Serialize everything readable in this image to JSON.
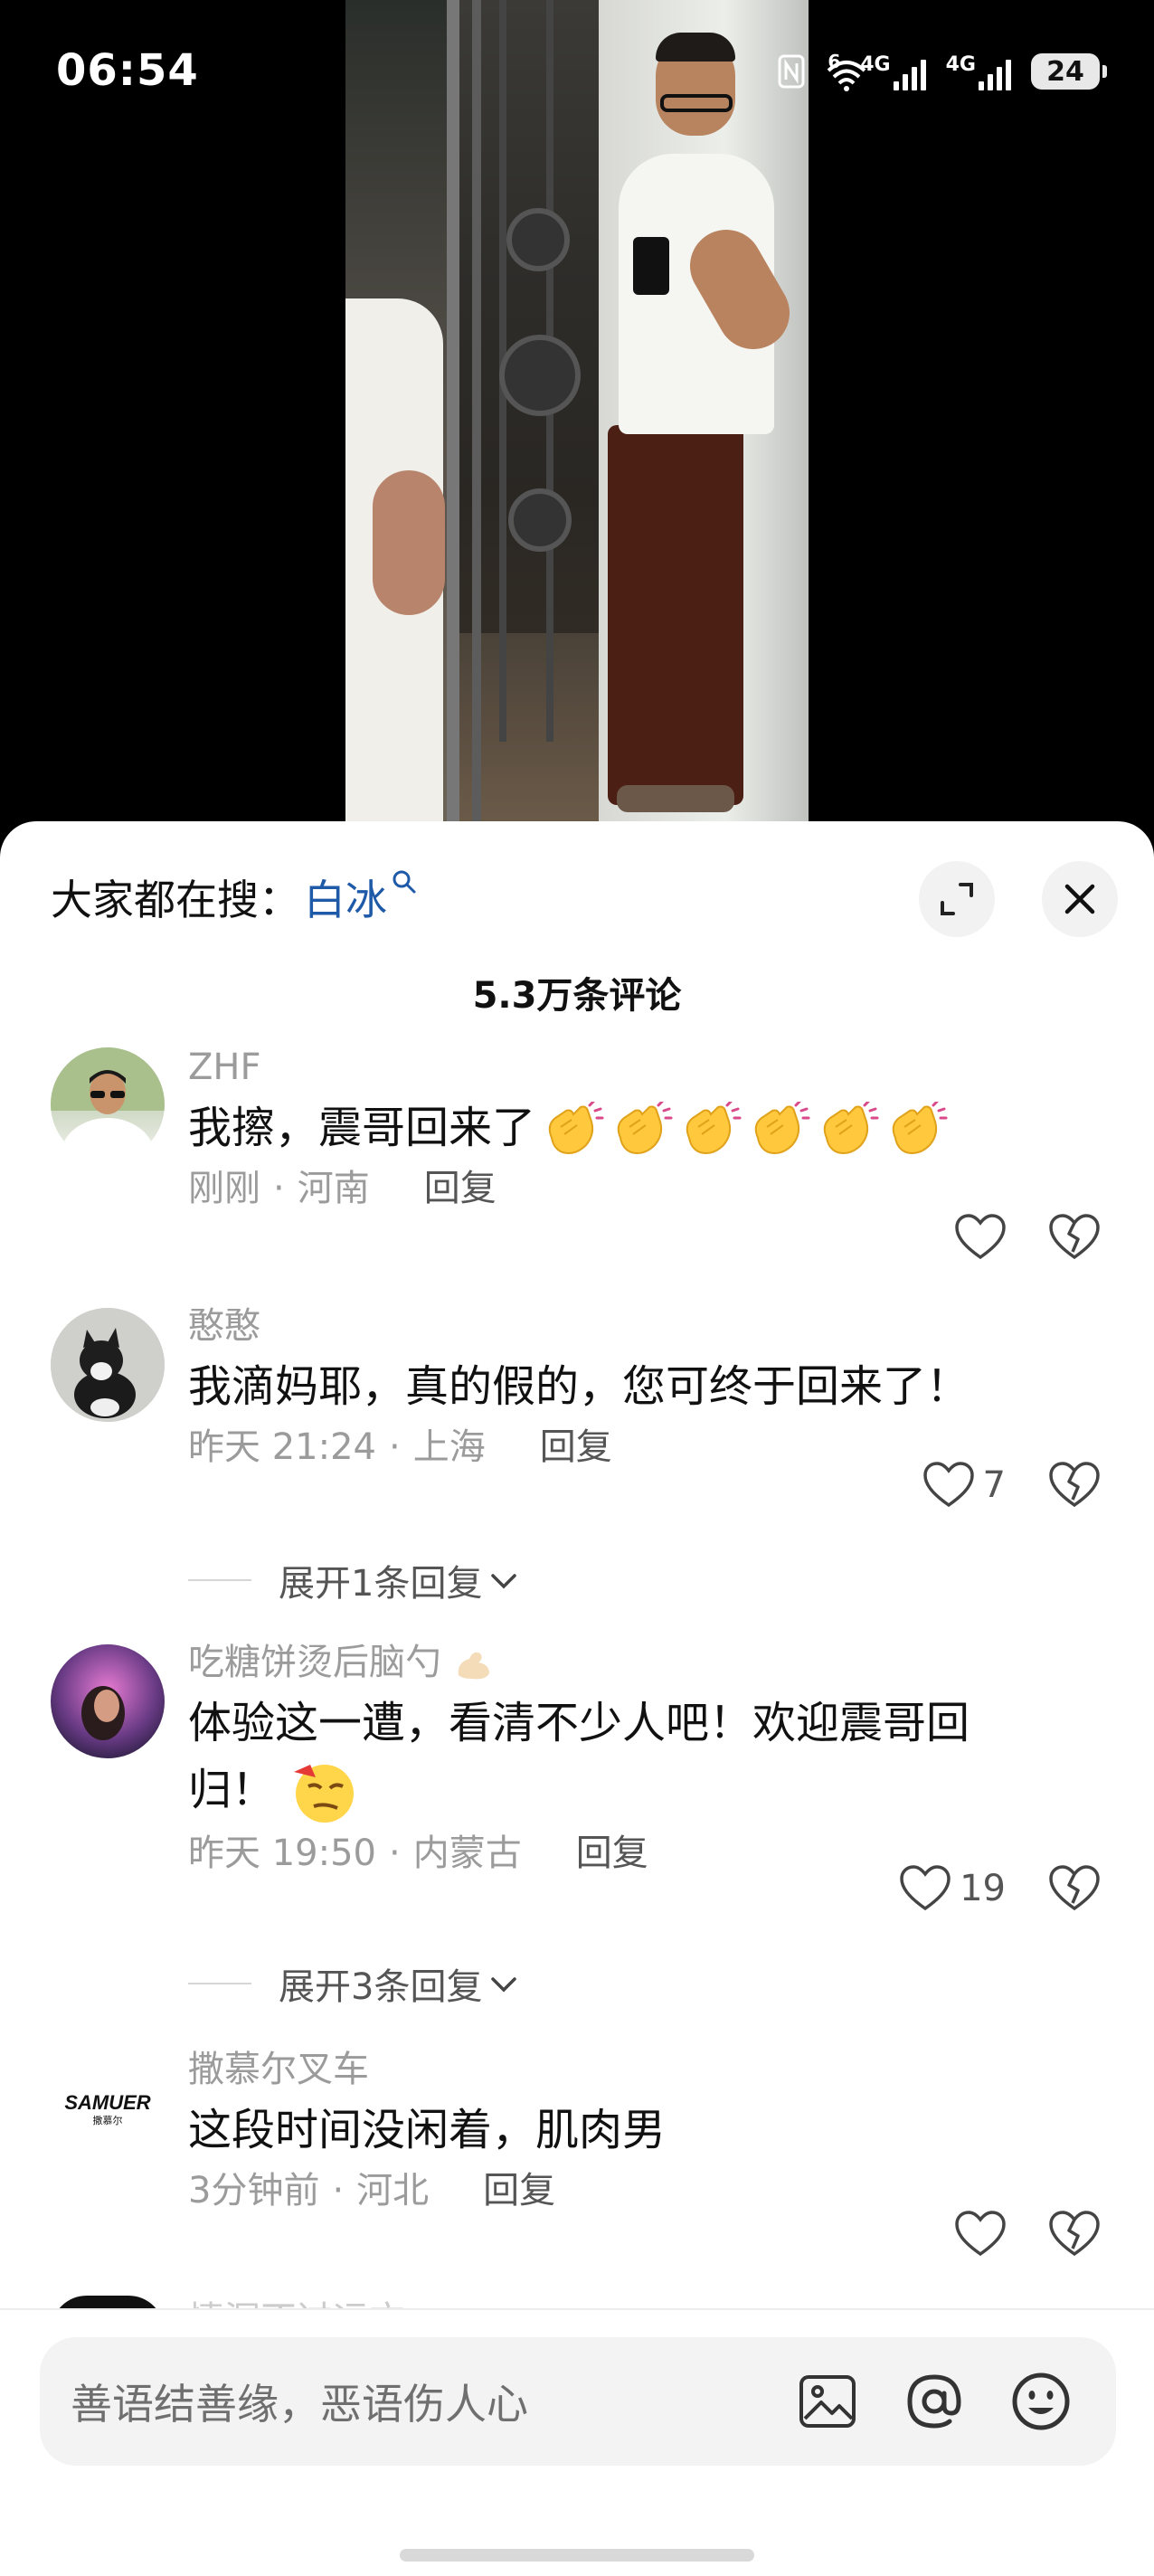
{
  "status_bar": {
    "time": "06:54",
    "network_1": "4G",
    "network_2": "4G",
    "wifi_label": "6",
    "battery": "24"
  },
  "panel": {
    "search_prefix": "大家都在搜：",
    "search_term": "白冰",
    "comment_count": "5.3万条评论",
    "comments": [
      {
        "user": "ZHF",
        "text": "我擦，震哥回来了",
        "emoji": "clapping-hands-emoji",
        "emoji_count": 6,
        "time": "刚刚",
        "location": "河南",
        "reply_label": "回复",
        "likes": ""
      },
      {
        "user": "憨憨",
        "text": "我滴妈耶，真的假的，您可终于回来了！",
        "time": "昨天 21:24",
        "location": "上海",
        "reply_label": "回复",
        "likes": "7",
        "expand_label": "展开1条回复"
      },
      {
        "user": "吃糖饼烫后脑勺",
        "text_line1": "体验这一遭，看清不少人吧！欢迎震哥回",
        "text_line2": "归！",
        "emoji": "smirk-emoji",
        "time": "昨天 19:50",
        "location": "内蒙古",
        "reply_label": "回复",
        "likes": "19",
        "expand_label": "展开3条回复"
      },
      {
        "user": "撒慕尔叉车",
        "text": "这段时间没闲着，肌肉男",
        "time": "3分钟前",
        "location": "河北",
        "reply_label": "回复",
        "likes": "",
        "avatar_logo": "SAMUER",
        "avatar_logo_sub": "撒慕尔"
      }
    ],
    "partial_user": "情深不过远方"
  },
  "input": {
    "placeholder": "善语结善缘，恶语伤人心"
  },
  "icons": {
    "expand": "expand-icon",
    "close": "close-icon",
    "search": "search-icon",
    "like": "heart-icon",
    "dislike": "broken-heart-icon",
    "image": "image-icon",
    "at": "at-icon",
    "emoji": "emoji-icon"
  },
  "colors": {
    "accent_link": "#1e5aa8",
    "secondary_text": "#9b9b9b"
  }
}
